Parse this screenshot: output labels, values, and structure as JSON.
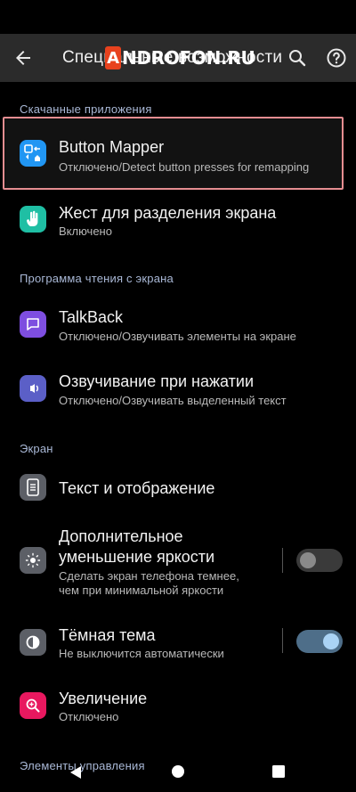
{
  "appbar": {
    "title": "Специальные возможности"
  },
  "watermark": {
    "text": "ANDROFON.RU"
  },
  "sections": {
    "downloaded": "Скачанные приложения",
    "screen_reader": "Программа чтения с экрана",
    "display": "Экран",
    "controls": "Элементы управления"
  },
  "items": {
    "button_mapper": {
      "title": "Button Mapper",
      "subtitle": "Отключено/Detect button presses for remapping"
    },
    "split_gesture": {
      "title": "Жест для разделения экрана",
      "subtitle": "Включено"
    },
    "talkback": {
      "title": "TalkBack",
      "subtitle": "Отключено/Озвучивать элементы на экране"
    },
    "select_to_speak": {
      "title": "Озвучивание при нажатии",
      "subtitle": "Отключено/Озвучивать выделенный текст"
    },
    "text_display": {
      "title": "Текст и отображение"
    },
    "extra_dim": {
      "title_line1": "Дополнительное",
      "title_line2": "уменьшение яркости",
      "subtitle_line1": "Сделать экран телефона темнее,",
      "subtitle_line2": "чем при минимальной яркости",
      "enabled": false
    },
    "dark_theme": {
      "title": "Тёмная тема",
      "subtitle": "Не выключится автоматически",
      "enabled": true
    },
    "magnification": {
      "title": "Увеличение",
      "subtitle": "Отключено"
    }
  },
  "colors": {
    "accent_highlight": "#e58d91",
    "toggle_on_track": "#4e6e89",
    "toggle_on_knob": "#aad3f5",
    "toggle_off_track": "#3a3a3a",
    "toggle_off_knob": "#8a8a8a"
  }
}
